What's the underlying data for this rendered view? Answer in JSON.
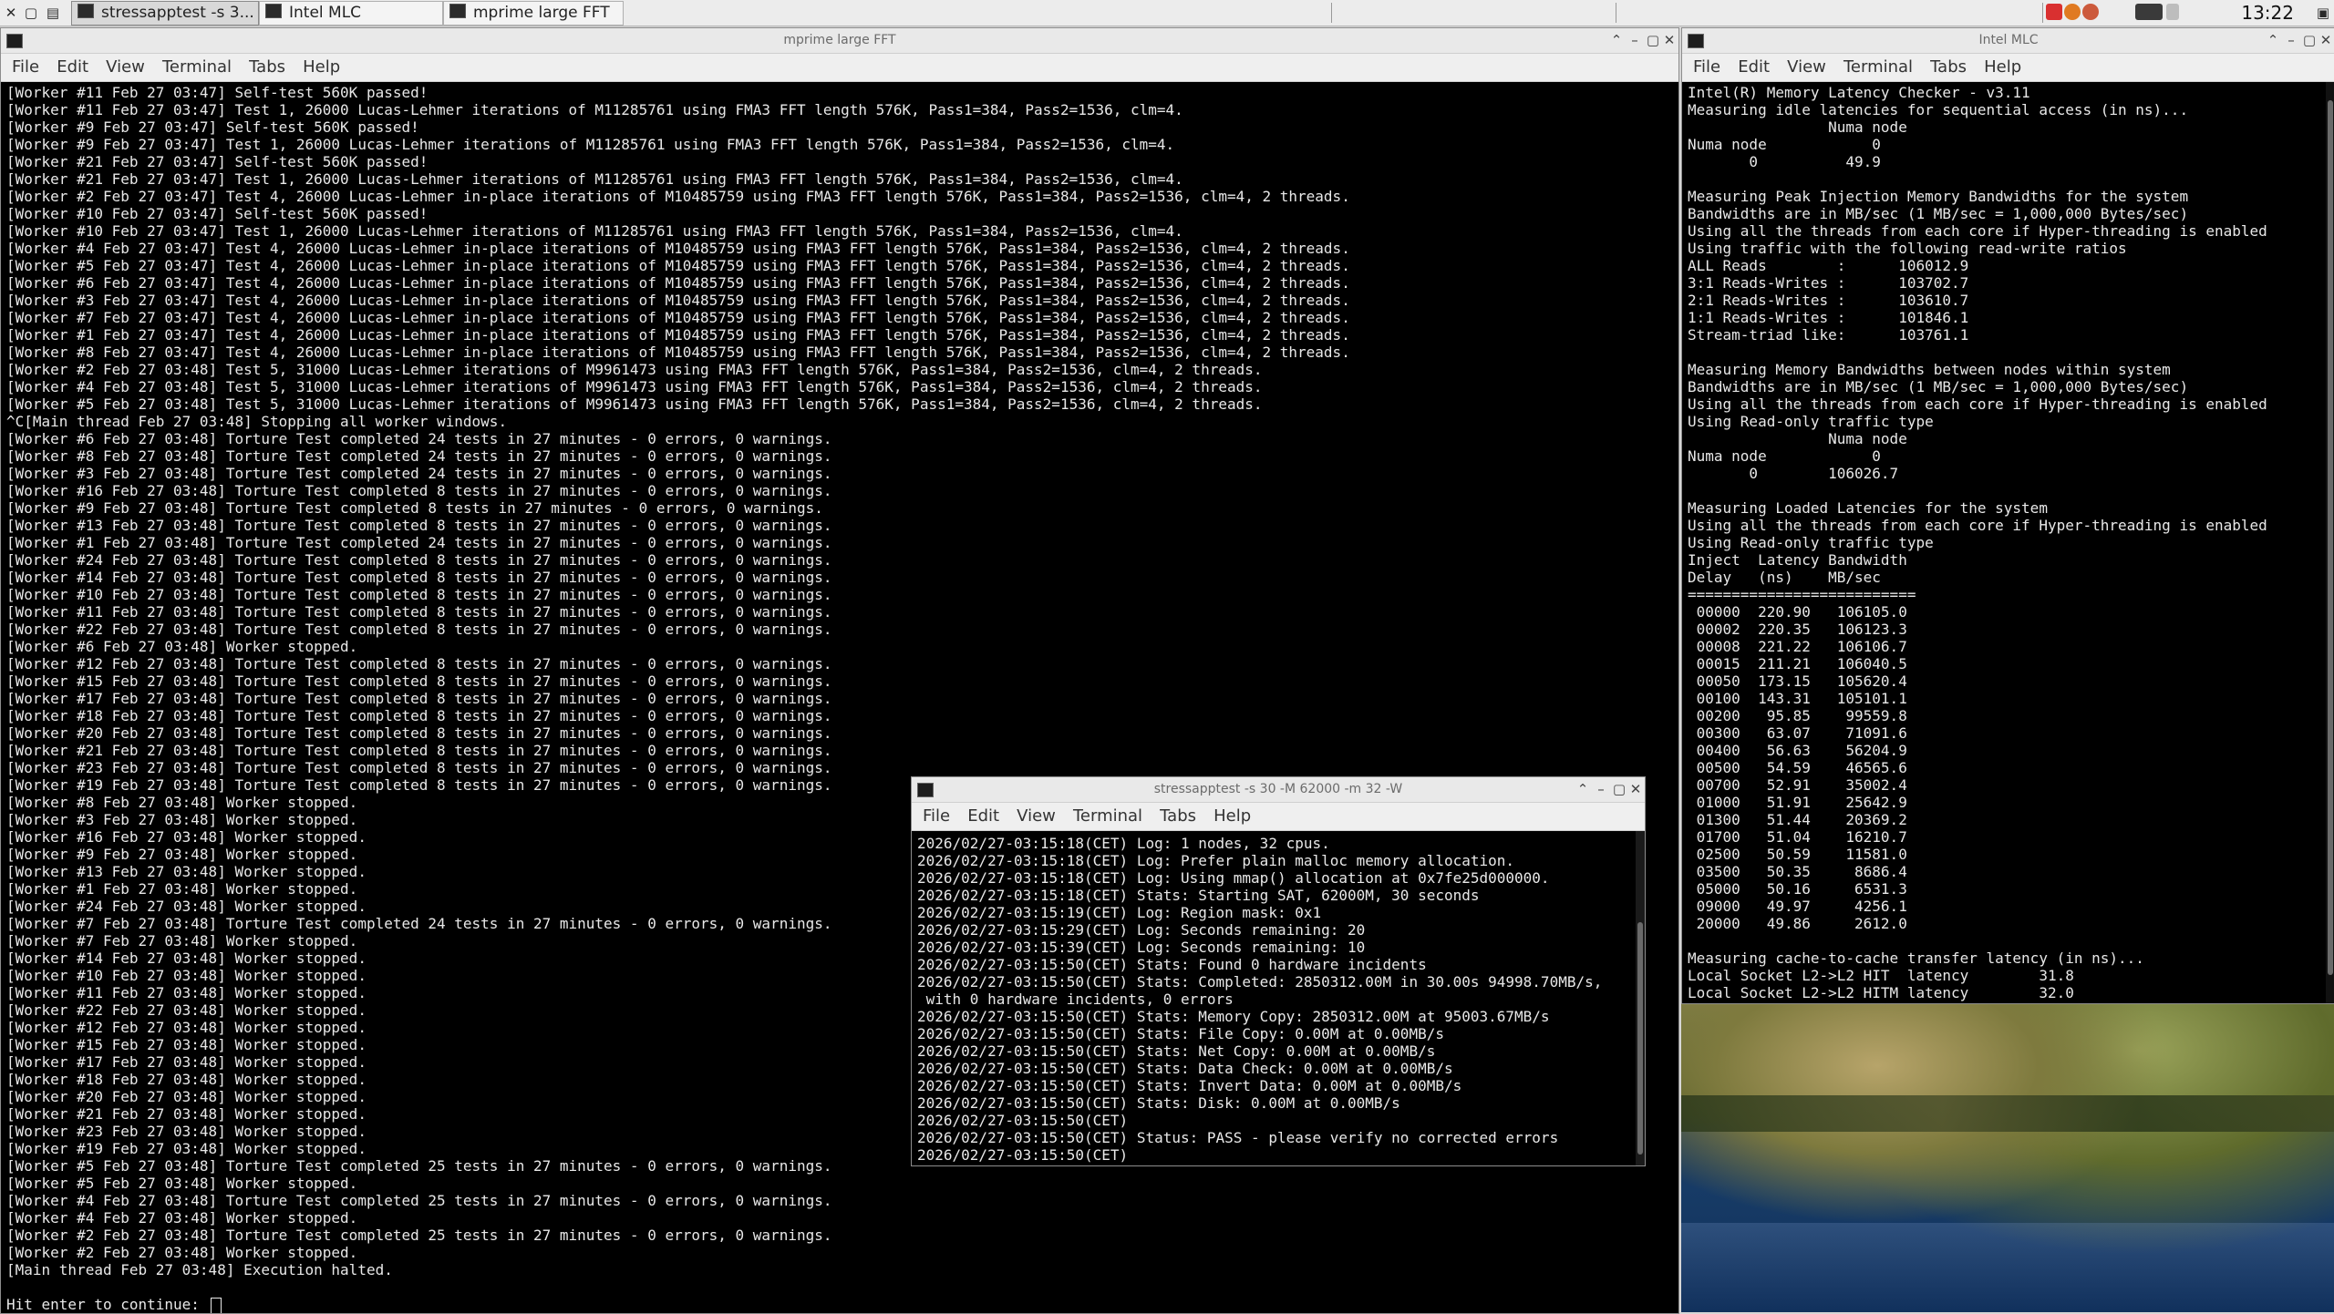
{
  "taskbar": {
    "tasks": [
      {
        "label": "stressapptest -s 3...",
        "active": true
      },
      {
        "label": "Intel MLC",
        "active": false
      },
      {
        "label": "mprime large FFT",
        "active": false
      }
    ],
    "clock": "13:22"
  },
  "windows": {
    "mprime": {
      "title": "mprime large FFT",
      "menu": [
        "File",
        "Edit",
        "View",
        "Terminal",
        "Tabs",
        "Help"
      ],
      "lines": [
        "[Worker #11 Feb 27 03:47] Self-test 560K passed!",
        "[Worker #11 Feb 27 03:47] Test 1, 26000 Lucas-Lehmer iterations of M11285761 using FMA3 FFT length 576K, Pass1=384, Pass2=1536, clm=4.",
        "[Worker #9 Feb 27 03:47] Self-test 560K passed!",
        "[Worker #9 Feb 27 03:47] Test 1, 26000 Lucas-Lehmer iterations of M11285761 using FMA3 FFT length 576K, Pass1=384, Pass2=1536, clm=4.",
        "[Worker #21 Feb 27 03:47] Self-test 560K passed!",
        "[Worker #21 Feb 27 03:47] Test 1, 26000 Lucas-Lehmer iterations of M11285761 using FMA3 FFT length 576K, Pass1=384, Pass2=1536, clm=4.",
        "[Worker #2 Feb 27 03:47] Test 4, 26000 Lucas-Lehmer in-place iterations of M10485759 using FMA3 FFT length 576K, Pass1=384, Pass2=1536, clm=4, 2 threads.",
        "[Worker #10 Feb 27 03:47] Self-test 560K passed!",
        "[Worker #10 Feb 27 03:47] Test 1, 26000 Lucas-Lehmer iterations of M11285761 using FMA3 FFT length 576K, Pass1=384, Pass2=1536, clm=4.",
        "[Worker #4 Feb 27 03:47] Test 4, 26000 Lucas-Lehmer in-place iterations of M10485759 using FMA3 FFT length 576K, Pass1=384, Pass2=1536, clm=4, 2 threads.",
        "[Worker #5 Feb 27 03:47] Test 4, 26000 Lucas-Lehmer in-place iterations of M10485759 using FMA3 FFT length 576K, Pass1=384, Pass2=1536, clm=4, 2 threads.",
        "[Worker #6 Feb 27 03:47] Test 4, 26000 Lucas-Lehmer in-place iterations of M10485759 using FMA3 FFT length 576K, Pass1=384, Pass2=1536, clm=4, 2 threads.",
        "[Worker #3 Feb 27 03:47] Test 4, 26000 Lucas-Lehmer in-place iterations of M10485759 using FMA3 FFT length 576K, Pass1=384, Pass2=1536, clm=4, 2 threads.",
        "[Worker #7 Feb 27 03:47] Test 4, 26000 Lucas-Lehmer in-place iterations of M10485759 using FMA3 FFT length 576K, Pass1=384, Pass2=1536, clm=4, 2 threads.",
        "[Worker #1 Feb 27 03:47] Test 4, 26000 Lucas-Lehmer in-place iterations of M10485759 using FMA3 FFT length 576K, Pass1=384, Pass2=1536, clm=4, 2 threads.",
        "[Worker #8 Feb 27 03:47] Test 4, 26000 Lucas-Lehmer in-place iterations of M10485759 using FMA3 FFT length 576K, Pass1=384, Pass2=1536, clm=4, 2 threads.",
        "[Worker #2 Feb 27 03:48] Test 5, 31000 Lucas-Lehmer iterations of M9961473 using FMA3 FFT length 576K, Pass1=384, Pass2=1536, clm=4, 2 threads.",
        "[Worker #4 Feb 27 03:48] Test 5, 31000 Lucas-Lehmer iterations of M9961473 using FMA3 FFT length 576K, Pass1=384, Pass2=1536, clm=4, 2 threads.",
        "[Worker #5 Feb 27 03:48] Test 5, 31000 Lucas-Lehmer iterations of M9961473 using FMA3 FFT length 576K, Pass1=384, Pass2=1536, clm=4, 2 threads.",
        "^C[Main thread Feb 27 03:48] Stopping all worker windows.",
        "[Worker #6 Feb 27 03:48] Torture Test completed 24 tests in 27 minutes - 0 errors, 0 warnings.",
        "[Worker #8 Feb 27 03:48] Torture Test completed 24 tests in 27 minutes - 0 errors, 0 warnings.",
        "[Worker #3 Feb 27 03:48] Torture Test completed 24 tests in 27 minutes - 0 errors, 0 warnings.",
        "[Worker #16 Feb 27 03:48] Torture Test completed 8 tests in 27 minutes - 0 errors, 0 warnings.",
        "[Worker #9 Feb 27 03:48] Torture Test completed 8 tests in 27 minutes - 0 errors, 0 warnings.",
        "[Worker #13 Feb 27 03:48] Torture Test completed 8 tests in 27 minutes - 0 errors, 0 warnings.",
        "[Worker #1 Feb 27 03:48] Torture Test completed 24 tests in 27 minutes - 0 errors, 0 warnings.",
        "[Worker #24 Feb 27 03:48] Torture Test completed 8 tests in 27 minutes - 0 errors, 0 warnings.",
        "[Worker #14 Feb 27 03:48] Torture Test completed 8 tests in 27 minutes - 0 errors, 0 warnings.",
        "[Worker #10 Feb 27 03:48] Torture Test completed 8 tests in 27 minutes - 0 errors, 0 warnings.",
        "[Worker #11 Feb 27 03:48] Torture Test completed 8 tests in 27 minutes - 0 errors, 0 warnings.",
        "[Worker #22 Feb 27 03:48] Torture Test completed 8 tests in 27 minutes - 0 errors, 0 warnings.",
        "[Worker #6 Feb 27 03:48] Worker stopped.",
        "[Worker #12 Feb 27 03:48] Torture Test completed 8 tests in 27 minutes - 0 errors, 0 warnings.",
        "[Worker #15 Feb 27 03:48] Torture Test completed 8 tests in 27 minutes - 0 errors, 0 warnings.",
        "[Worker #17 Feb 27 03:48] Torture Test completed 8 tests in 27 minutes - 0 errors, 0 warnings.",
        "[Worker #18 Feb 27 03:48] Torture Test completed 8 tests in 27 minutes - 0 errors, 0 warnings.",
        "[Worker #20 Feb 27 03:48] Torture Test completed 8 tests in 27 minutes - 0 errors, 0 warnings.",
        "[Worker #21 Feb 27 03:48] Torture Test completed 8 tests in 27 minutes - 0 errors, 0 warnings.",
        "[Worker #23 Feb 27 03:48] Torture Test completed 8 tests in 27 minutes - 0 errors, 0 warnings.",
        "[Worker #19 Feb 27 03:48] Torture Test completed 8 tests in 27 minutes - 0 errors, 0 warnings.",
        "[Worker #8 Feb 27 03:48] Worker stopped.",
        "[Worker #3 Feb 27 03:48] Worker stopped.",
        "[Worker #16 Feb 27 03:48] Worker stopped.",
        "[Worker #9 Feb 27 03:48] Worker stopped.",
        "[Worker #13 Feb 27 03:48] Worker stopped.",
        "[Worker #1 Feb 27 03:48] Worker stopped.",
        "[Worker #24 Feb 27 03:48] Worker stopped.",
        "[Worker #7 Feb 27 03:48] Torture Test completed 24 tests in 27 minutes - 0 errors, 0 warnings.",
        "[Worker #7 Feb 27 03:48] Worker stopped.",
        "[Worker #14 Feb 27 03:48] Worker stopped.",
        "[Worker #10 Feb 27 03:48] Worker stopped.",
        "[Worker #11 Feb 27 03:48] Worker stopped.",
        "[Worker #22 Feb 27 03:48] Worker stopped.",
        "[Worker #12 Feb 27 03:48] Worker stopped.",
        "[Worker #15 Feb 27 03:48] Worker stopped.",
        "[Worker #17 Feb 27 03:48] Worker stopped.",
        "[Worker #18 Feb 27 03:48] Worker stopped.",
        "[Worker #20 Feb 27 03:48] Worker stopped.",
        "[Worker #21 Feb 27 03:48] Worker stopped.",
        "[Worker #23 Feb 27 03:48] Worker stopped.",
        "[Worker #19 Feb 27 03:48] Worker stopped.",
        "[Worker #5 Feb 27 03:48] Torture Test completed 25 tests in 27 minutes - 0 errors, 0 warnings.",
        "[Worker #5 Feb 27 03:48] Worker stopped.",
        "[Worker #4 Feb 27 03:48] Torture Test completed 25 tests in 27 minutes - 0 errors, 0 warnings.",
        "[Worker #4 Feb 27 03:48] Worker stopped.",
        "[Worker #2 Feb 27 03:48] Torture Test completed 25 tests in 27 minutes - 0 errors, 0 warnings.",
        "[Worker #2 Feb 27 03:48] Worker stopped.",
        "[Main thread Feb 27 03:48] Execution halted.",
        ""
      ],
      "prompt": "Hit enter to continue: "
    },
    "mlc": {
      "title": "Intel MLC",
      "menu": [
        "File",
        "Edit",
        "View",
        "Terminal",
        "Tabs",
        "Help"
      ],
      "lines": [
        "Intel(R) Memory Latency Checker - v3.11",
        "Measuring idle latencies for sequential access (in ns)...",
        "                Numa node",
        "Numa node            0",
        "       0          49.9",
        "",
        "Measuring Peak Injection Memory Bandwidths for the system",
        "Bandwidths are in MB/sec (1 MB/sec = 1,000,000 Bytes/sec)",
        "Using all the threads from each core if Hyper-threading is enabled",
        "Using traffic with the following read-write ratios",
        "ALL Reads        :      106012.9",
        "3:1 Reads-Writes :      103702.7",
        "2:1 Reads-Writes :      103610.7",
        "1:1 Reads-Writes :      101846.1",
        "Stream-triad like:      103761.1",
        "",
        "Measuring Memory Bandwidths between nodes within system",
        "Bandwidths are in MB/sec (1 MB/sec = 1,000,000 Bytes/sec)",
        "Using all the threads from each core if Hyper-threading is enabled",
        "Using Read-only traffic type",
        "                Numa node",
        "Numa node            0",
        "       0        106026.7",
        "",
        "Measuring Loaded Latencies for the system",
        "Using all the threads from each core if Hyper-threading is enabled",
        "Using Read-only traffic type",
        "Inject  Latency Bandwidth",
        "Delay   (ns)    MB/sec",
        "==========================",
        " 00000  220.90   106105.0",
        " 00002  220.35   106123.3",
        " 00008  221.22   106106.7",
        " 00015  211.21   106040.5",
        " 00050  173.15   105620.4",
        " 00100  143.31   105101.1",
        " 00200   95.85    99559.8",
        " 00300   63.07    71091.6",
        " 00400   56.63    56204.9",
        " 00500   54.59    46565.6",
        " 00700   52.91    35002.4",
        " 01000   51.91    25642.9",
        " 01300   51.44    20369.2",
        " 01700   51.04    16210.7",
        " 02500   50.59    11581.0",
        " 03500   50.35     8686.4",
        " 05000   50.16     6531.3",
        " 09000   49.97     4256.1",
        " 20000   49.86     2612.0",
        "",
        "Measuring cache-to-cache transfer latency (in ns)...",
        "Local Socket L2->L2 HIT  latency        31.8",
        "Local Socket L2->L2 HITM latency        32.0"
      ]
    },
    "stress": {
      "title": "stressapptest -s 30 -M 62000 -m 32 -W",
      "menu": [
        "File",
        "Edit",
        "View",
        "Terminal",
        "Tabs",
        "Help"
      ],
      "lines": [
        "2026/02/27-03:15:18(CET) Log: 1 nodes, 32 cpus.",
        "2026/02/27-03:15:18(CET) Log: Prefer plain malloc memory allocation.",
        "2026/02/27-03:15:18(CET) Log: Using mmap() allocation at 0x7fe25d000000.",
        "2026/02/27-03:15:18(CET) Stats: Starting SAT, 62000M, 30 seconds",
        "2026/02/27-03:15:19(CET) Log: Region mask: 0x1",
        "2026/02/27-03:15:29(CET) Log: Seconds remaining: 20",
        "2026/02/27-03:15:39(CET) Log: Seconds remaining: 10",
        "2026/02/27-03:15:50(CET) Stats: Found 0 hardware incidents",
        "2026/02/27-03:15:50(CET) Stats: Completed: 2850312.00M in 30.00s 94998.70MB/s,",
        " with 0 hardware incidents, 0 errors",
        "2026/02/27-03:15:50(CET) Stats: Memory Copy: 2850312.00M at 95003.67MB/s",
        "2026/02/27-03:15:50(CET) Stats: File Copy: 0.00M at 0.00MB/s",
        "2026/02/27-03:15:50(CET) Stats: Net Copy: 0.00M at 0.00MB/s",
        "2026/02/27-03:15:50(CET) Stats: Data Check: 0.00M at 0.00MB/s",
        "2026/02/27-03:15:50(CET) Stats: Invert Data: 0.00M at 0.00MB/s",
        "2026/02/27-03:15:50(CET) Stats: Disk: 0.00M at 0.00MB/s",
        "2026/02/27-03:15:50(CET)",
        "2026/02/27-03:15:50(CET) Status: PASS - please verify no corrected errors",
        "2026/02/27-03:15:50(CET)"
      ]
    }
  }
}
